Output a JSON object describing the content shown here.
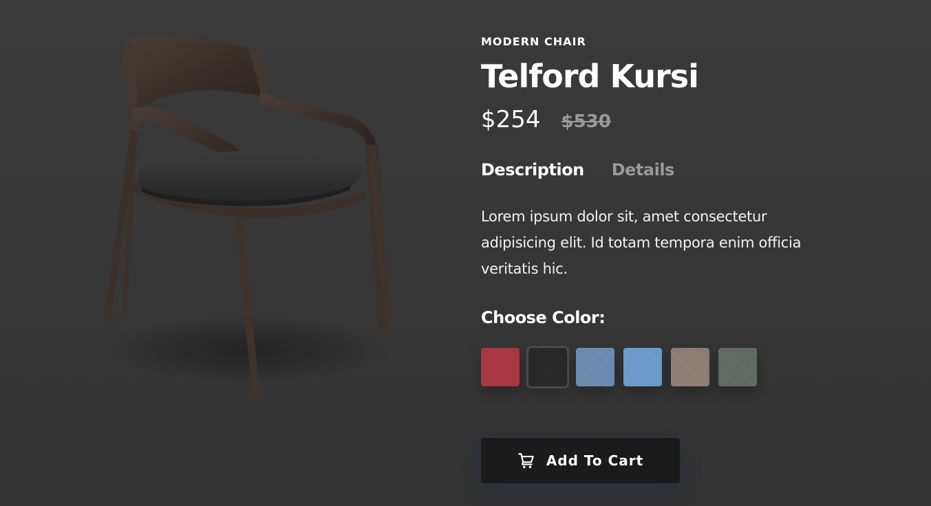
{
  "product": {
    "category": "MODERN CHAIR",
    "name": "Telford Kursi",
    "price": "$254",
    "old_price": "$530",
    "image_icon": "chair-image"
  },
  "tabs": [
    {
      "label": "Description",
      "active": true
    },
    {
      "label": "Details",
      "active": false
    }
  ],
  "description": "Lorem ipsum dolor sit, amet consectetur adipisicing elit. Id totam tempora enim officia veritatis hic.",
  "color_picker": {
    "label": "Choose Color:",
    "swatches": [
      {
        "name": "red",
        "color": "#a8323f",
        "selected": false
      },
      {
        "name": "black",
        "color": "#232323",
        "selected": true
      },
      {
        "name": "denim",
        "color": "#6b8bb0",
        "selected": false
      },
      {
        "name": "sky-blue",
        "color": "#6a9ccf",
        "selected": false
      },
      {
        "name": "taupe",
        "color": "#8d7e74",
        "selected": false
      },
      {
        "name": "grey-green",
        "color": "#5f6862",
        "selected": false
      }
    ]
  },
  "cart": {
    "label": "Add To Cart",
    "icon": "cart-icon"
  }
}
